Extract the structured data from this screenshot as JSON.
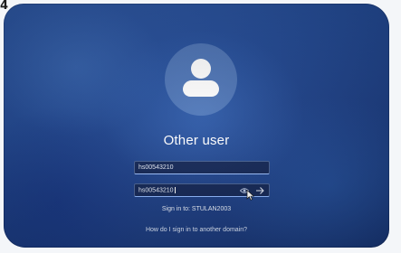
{
  "corner_mark": "4",
  "login": {
    "title": "Other user",
    "username_value": "hs00543210",
    "password_value": "hs00543210",
    "sign_in_to": "Sign in to: STULAN2003",
    "help_link": "How do I sign in to another domain?"
  },
  "icons": {
    "avatar": "user-avatar-icon",
    "reveal": "eye-reveal-icon",
    "submit": "arrow-right-icon",
    "cursor": "mouse-pointer-icon"
  },
  "colors": {
    "background_blue": "#244c98",
    "text": "#ffffff",
    "field_bg": "#122048",
    "field_accent": "#9fc2ff"
  }
}
